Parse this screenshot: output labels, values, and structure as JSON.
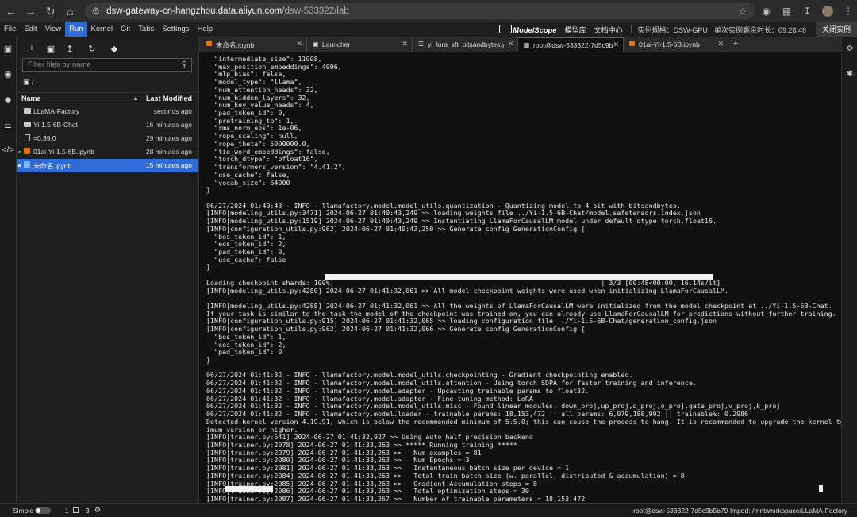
{
  "browser": {
    "url_host": "dsw-gateway-cn-hangzhou.data.aliyun.com",
    "url_path": "/dsw-533322/lab"
  },
  "menu": {
    "items": [
      "File",
      "Edit",
      "View",
      "Run",
      "Kernel",
      "Git",
      "Tabs",
      "Settings",
      "Help"
    ],
    "active": "Run",
    "logo": "ModelScope",
    "model_lib": "模型库",
    "doc_center": "文档中心",
    "instance_spec": "实例规格：DSW-GPU",
    "remaining_time": "单次实例剩余时长：09:28:46",
    "close_instance": "关闭实例"
  },
  "filebrowser": {
    "filter_placeholder": "Filter files by name",
    "breadcrumb": "/",
    "col_name": "Name",
    "col_modified": "Last Modified",
    "files": [
      {
        "name": "LLaMA-Factory",
        "modified": "seconds ago",
        "type": "folder",
        "running": false,
        "selected": false
      },
      {
        "name": "Yi-1.5-6B-Chat",
        "modified": "16 minutes ago",
        "type": "folder",
        "running": false,
        "selected": false
      },
      {
        "name": "=0.39.0",
        "modified": "29 minutes ago",
        "type": "file",
        "running": false,
        "selected": false
      },
      {
        "name": "01ai-Yi-1.5-6B.ipynb",
        "modified": "28 minutes ago",
        "type": "notebook",
        "running": true,
        "selected": false
      },
      {
        "name": "未命名.ipynb",
        "modified": "15 minutes ago",
        "type": "notebook",
        "running": true,
        "selected": true
      }
    ]
  },
  "tabs": [
    {
      "label": "未命名.ipynb",
      "icon": "notebook-icon",
      "active": false
    },
    {
      "label": "Launcher",
      "icon": "launcher-icon",
      "active": false
    },
    {
      "label": "yi_lora_sft_bitsandbytes.yaml",
      "icon": "text-file-icon",
      "active": false
    },
    {
      "label": "root@dsw-533322-7d5c9b5",
      "icon": "terminal-icon",
      "active": true
    },
    {
      "label": "01ai-Yi-1.5-6B.ipynb",
      "icon": "notebook-icon",
      "active": false
    }
  ],
  "terminal": {
    "text": "  \"intermediate_size\": 11008,\n  \"max_position_embeddings\": 4096,\n  \"mlp_bias\": false,\n  \"model_type\": \"llama\",\n  \"num_attention_heads\": 32,\n  \"num_hidden_layers\": 32,\n  \"num_key_value_heads\": 4,\n  \"pad_token_id\": 0,\n  \"pretraining_tp\": 1,\n  \"rms_norm_eps\": 1e-06,\n  \"rope_scaling\": null,\n  \"rope_theta\": 5000000.0,\n  \"tie_word_embeddings\": false,\n  \"torch_dtype\": \"bfloat16\",\n  \"transformers_version\": \"4.41.2\",\n  \"use_cache\": false,\n  \"vocab_size\": 64000\n}\n\n06/27/2024 01:40:43 - INFO - llamafactory.model.model_utils.quantization - Quantizing model to 4 bit with bitsandbytes.\n[INFO|modeling_utils.py:3471] 2024-06-27 01:40:43,249 >> loading weights file ../Yi-1.5-6B-Chat/model.safetensors.index.json\n[INFO|modeling_utils.py:1519] 2024-06-27 01:40:43,249 >> Instantiating LlamaForCausalLM model under default dtype torch.float16.\n[INFO|configuration_utils.py:962] 2024-06-27 01:40:43,250 >> Generate config GenerationConfig {\n  \"bos_token_id\": 1,\n  \"eos_token_id\": 2,\n  \"pad_token_id\": 0,\n  \"use_cache\": false\n}\n\nLoading checkpoint shards: 100%|                                                                   | 3/3 [00:48<00:00, 16.14s/it]\n[INFO|modeling_utils.py:4280] 2024-06-27 01:41:32,061 >> All model checkpoint weights were used when initializing LlamaForCausalLM.\n\n[INFO|modeling_utils.py:4288] 2024-06-27 01:41:32,061 >> All the weights of LlamaForCausalLM were initialized from the model checkpoint at ../Yi-1.5-6B-Chat.\nIf your task is similar to the task the model of the checkpoint was trained on, you can already use LlamaForCausalLM for predictions without further training.\n[INFO|configuration_utils.py:915] 2024-06-27 01:41:32,065 >> loading configuration file ../Yi-1.5-6B-Chat/generation_config.json\n[INFO|configuration_utils.py:962] 2024-06-27 01:41:32,066 >> Generate config GenerationConfig {\n  \"bos_token_id\": 1,\n  \"eos_token_id\": 2,\n  \"pad_token_id\": 0\n}\n\n06/27/2024 01:41:32 - INFO - llamafactory.model.model_utils.checkpointing - Gradient checkpointing enabled.\n06/27/2024 01:41:32 - INFO - llamafactory.model.model_utils.attention - Using torch SDPA for faster training and inference.\n06/27/2024 01:41:32 - INFO - llamafactory.model.adapter - Upcasting trainable params to float32.\n06/27/2024 01:41:32 - INFO - llamafactory.model.adapter - Fine-tuning method: LoRA\n06/27/2024 01:41:32 - INFO - llamafactory.model.model_utils.misc - Found linear modules: down_proj,up_proj,q_proj,o_proj,gate_proj,v_proj,k_proj\n06/27/2024 01:41:32 - INFO - llamafactory.model.loader - trainable params: 18,153,472 || all params: 6,079,188,992 || trainable%: 0.2986\nDetected kernel version 4.19.91, which is below the recommended minimum of 5.5.0; this can cause the process to hang. It is recommended to upgrade the kernel to the min\nimum version or higher.\n[INFO|trainer.py:641] 2024-06-27 01:41:32,927 >> Using auto half precision backend\n[INFO|trainer.py:2078] 2024-06-27 01:41:33,263 >> ***** Running training *****\n[INFO|trainer.py:2079] 2024-06-27 01:41:33,263 >>   Num examples = 81\n[INFO|trainer.py:2080] 2024-06-27 01:41:33,263 >>   Num Epochs = 3\n[INFO|trainer.py:2081] 2024-06-27 01:41:33,263 >>   Instantaneous batch size per device = 1\n[INFO|trainer.py:2084] 2024-06-27 01:41:33,263 >>   Total train batch size (w. parallel, distributed & accumulation) = 8\n[INFO|trainer.py:2085] 2024-06-27 01:41:33,263 >>   Gradient Accumulation steps = 8\n[INFO|trainer.py:2086] 2024-06-27 01:41:33,263 >>   Total optimization steps = 30\n[INFO|trainer.py:2087] 2024-06-27 01:41:33,267 >>   Number of trainable parameters = 18,153,472\n                                                                                                                                     | 3/30 [00:11<01:34,  3.50s/it]\n 10%|",
    "shards_progress_pct": 100,
    "training_progress_pct": 10
  },
  "status": {
    "mode_label": "Simple",
    "count_a": "1",
    "count_b": "3",
    "right_text": "root@dsw-533322-7d5c9b5b79-lmpqd: /mnt/workspace/LLaMA-Factory"
  }
}
